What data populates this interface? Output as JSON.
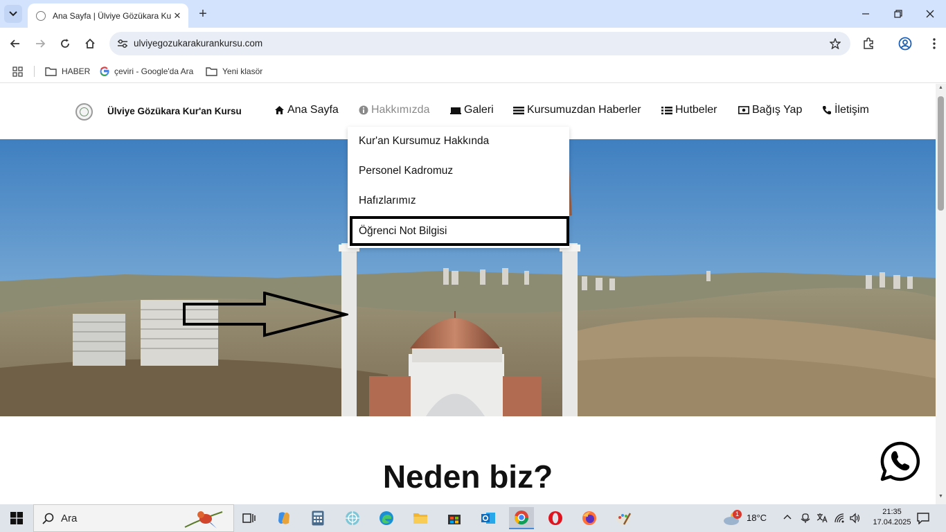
{
  "browser": {
    "tab_title": "Ana Sayfa | Ülviye Gözükara Kur'an Kursu",
    "url": "ulviyegozukarakurankursu.com",
    "bookmarks": [
      {
        "label": "HABER",
        "icon": "folder-icon"
      },
      {
        "label": "çeviri - Google'da Ara",
        "icon": "google-icon"
      },
      {
        "label": "Yeni klasör",
        "icon": "folder-icon"
      }
    ]
  },
  "site": {
    "brand": "Ülviye Gözükara Kur'an Kursu",
    "menu": [
      {
        "label": "Ana Sayfa",
        "icon": "home-icon"
      },
      {
        "label": "Hakkımızda",
        "icon": "info-icon"
      },
      {
        "label": "Galeri",
        "icon": "gallery-icon"
      },
      {
        "label": "Kursumuzdan Haberler",
        "icon": "list-icon"
      },
      {
        "label": "Hutbeler",
        "icon": "bullet-list-icon"
      },
      {
        "label": "Bağış Yap",
        "icon": "money-icon"
      },
      {
        "label": "İletişim",
        "icon": "phone-icon"
      }
    ],
    "dropdown": [
      "Kur'an Kursumuz Hakkında",
      "Personel Kadromuz",
      "Hafızlarımız",
      "Öğrenci Not Bilgisi"
    ],
    "section_title": "Neden biz?"
  },
  "taskbar": {
    "search_placeholder": "Ara",
    "weather": "18°C",
    "weather_badge": "1",
    "time": "21:35",
    "date": "17.04.2025"
  },
  "colors": {
    "tab_strip": "#d3e3fd",
    "omnibox": "#e9eef6",
    "sky_top": "#3f7fc0",
    "annotation": "#000000"
  }
}
